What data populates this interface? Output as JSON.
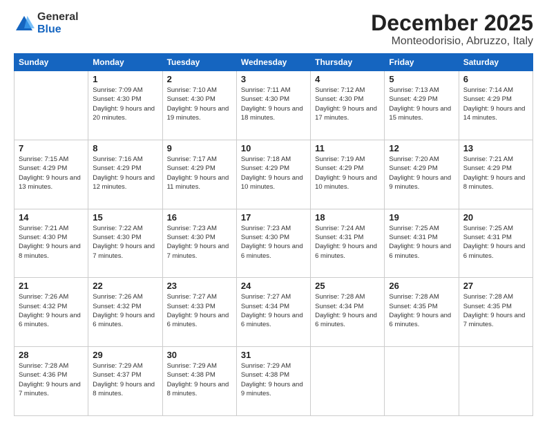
{
  "logo": {
    "general": "General",
    "blue": "Blue"
  },
  "header": {
    "month": "December 2025",
    "location": "Monteodorisio, Abruzzo, Italy"
  },
  "weekdays": [
    "Sunday",
    "Monday",
    "Tuesday",
    "Wednesday",
    "Thursday",
    "Friday",
    "Saturday"
  ],
  "weeks": [
    [
      {
        "day": "",
        "sunrise": "",
        "sunset": "",
        "daylight": ""
      },
      {
        "day": "1",
        "sunrise": "Sunrise: 7:09 AM",
        "sunset": "Sunset: 4:30 PM",
        "daylight": "Daylight: 9 hours and 20 minutes."
      },
      {
        "day": "2",
        "sunrise": "Sunrise: 7:10 AM",
        "sunset": "Sunset: 4:30 PM",
        "daylight": "Daylight: 9 hours and 19 minutes."
      },
      {
        "day": "3",
        "sunrise": "Sunrise: 7:11 AM",
        "sunset": "Sunset: 4:30 PM",
        "daylight": "Daylight: 9 hours and 18 minutes."
      },
      {
        "day": "4",
        "sunrise": "Sunrise: 7:12 AM",
        "sunset": "Sunset: 4:30 PM",
        "daylight": "Daylight: 9 hours and 17 minutes."
      },
      {
        "day": "5",
        "sunrise": "Sunrise: 7:13 AM",
        "sunset": "Sunset: 4:29 PM",
        "daylight": "Daylight: 9 hours and 15 minutes."
      },
      {
        "day": "6",
        "sunrise": "Sunrise: 7:14 AM",
        "sunset": "Sunset: 4:29 PM",
        "daylight": "Daylight: 9 hours and 14 minutes."
      }
    ],
    [
      {
        "day": "7",
        "sunrise": "Sunrise: 7:15 AM",
        "sunset": "Sunset: 4:29 PM",
        "daylight": "Daylight: 9 hours and 13 minutes."
      },
      {
        "day": "8",
        "sunrise": "Sunrise: 7:16 AM",
        "sunset": "Sunset: 4:29 PM",
        "daylight": "Daylight: 9 hours and 12 minutes."
      },
      {
        "day": "9",
        "sunrise": "Sunrise: 7:17 AM",
        "sunset": "Sunset: 4:29 PM",
        "daylight": "Daylight: 9 hours and 11 minutes."
      },
      {
        "day": "10",
        "sunrise": "Sunrise: 7:18 AM",
        "sunset": "Sunset: 4:29 PM",
        "daylight": "Daylight: 9 hours and 10 minutes."
      },
      {
        "day": "11",
        "sunrise": "Sunrise: 7:19 AM",
        "sunset": "Sunset: 4:29 PM",
        "daylight": "Daylight: 9 hours and 10 minutes."
      },
      {
        "day": "12",
        "sunrise": "Sunrise: 7:20 AM",
        "sunset": "Sunset: 4:29 PM",
        "daylight": "Daylight: 9 hours and 9 minutes."
      },
      {
        "day": "13",
        "sunrise": "Sunrise: 7:21 AM",
        "sunset": "Sunset: 4:29 PM",
        "daylight": "Daylight: 9 hours and 8 minutes."
      }
    ],
    [
      {
        "day": "14",
        "sunrise": "Sunrise: 7:21 AM",
        "sunset": "Sunset: 4:30 PM",
        "daylight": "Daylight: 9 hours and 8 minutes."
      },
      {
        "day": "15",
        "sunrise": "Sunrise: 7:22 AM",
        "sunset": "Sunset: 4:30 PM",
        "daylight": "Daylight: 9 hours and 7 minutes."
      },
      {
        "day": "16",
        "sunrise": "Sunrise: 7:23 AM",
        "sunset": "Sunset: 4:30 PM",
        "daylight": "Daylight: 9 hours and 7 minutes."
      },
      {
        "day": "17",
        "sunrise": "Sunrise: 7:23 AM",
        "sunset": "Sunset: 4:30 PM",
        "daylight": "Daylight: 9 hours and 6 minutes."
      },
      {
        "day": "18",
        "sunrise": "Sunrise: 7:24 AM",
        "sunset": "Sunset: 4:31 PM",
        "daylight": "Daylight: 9 hours and 6 minutes."
      },
      {
        "day": "19",
        "sunrise": "Sunrise: 7:25 AM",
        "sunset": "Sunset: 4:31 PM",
        "daylight": "Daylight: 9 hours and 6 minutes."
      },
      {
        "day": "20",
        "sunrise": "Sunrise: 7:25 AM",
        "sunset": "Sunset: 4:31 PM",
        "daylight": "Daylight: 9 hours and 6 minutes."
      }
    ],
    [
      {
        "day": "21",
        "sunrise": "Sunrise: 7:26 AM",
        "sunset": "Sunset: 4:32 PM",
        "daylight": "Daylight: 9 hours and 6 minutes."
      },
      {
        "day": "22",
        "sunrise": "Sunrise: 7:26 AM",
        "sunset": "Sunset: 4:32 PM",
        "daylight": "Daylight: 9 hours and 6 minutes."
      },
      {
        "day": "23",
        "sunrise": "Sunrise: 7:27 AM",
        "sunset": "Sunset: 4:33 PM",
        "daylight": "Daylight: 9 hours and 6 minutes."
      },
      {
        "day": "24",
        "sunrise": "Sunrise: 7:27 AM",
        "sunset": "Sunset: 4:34 PM",
        "daylight": "Daylight: 9 hours and 6 minutes."
      },
      {
        "day": "25",
        "sunrise": "Sunrise: 7:28 AM",
        "sunset": "Sunset: 4:34 PM",
        "daylight": "Daylight: 9 hours and 6 minutes."
      },
      {
        "day": "26",
        "sunrise": "Sunrise: 7:28 AM",
        "sunset": "Sunset: 4:35 PM",
        "daylight": "Daylight: 9 hours and 6 minutes."
      },
      {
        "day": "27",
        "sunrise": "Sunrise: 7:28 AM",
        "sunset": "Sunset: 4:35 PM",
        "daylight": "Daylight: 9 hours and 7 minutes."
      }
    ],
    [
      {
        "day": "28",
        "sunrise": "Sunrise: 7:28 AM",
        "sunset": "Sunset: 4:36 PM",
        "daylight": "Daylight: 9 hours and 7 minutes."
      },
      {
        "day": "29",
        "sunrise": "Sunrise: 7:29 AM",
        "sunset": "Sunset: 4:37 PM",
        "daylight": "Daylight: 9 hours and 8 minutes."
      },
      {
        "day": "30",
        "sunrise": "Sunrise: 7:29 AM",
        "sunset": "Sunset: 4:38 PM",
        "daylight": "Daylight: 9 hours and 8 minutes."
      },
      {
        "day": "31",
        "sunrise": "Sunrise: 7:29 AM",
        "sunset": "Sunset: 4:38 PM",
        "daylight": "Daylight: 9 hours and 9 minutes."
      },
      {
        "day": "",
        "sunrise": "",
        "sunset": "",
        "daylight": ""
      },
      {
        "day": "",
        "sunrise": "",
        "sunset": "",
        "daylight": ""
      },
      {
        "day": "",
        "sunrise": "",
        "sunset": "",
        "daylight": ""
      }
    ]
  ]
}
